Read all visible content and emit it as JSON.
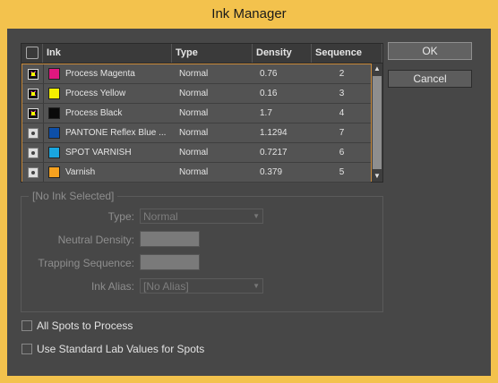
{
  "window": {
    "title": "Ink Manager"
  },
  "columns": {
    "icon": "",
    "ink": "Ink",
    "type": "Type",
    "density": "Density",
    "sequence": "Sequence"
  },
  "inks": [
    {
      "kind": "process",
      "color": "#e0177f",
      "name": "Process Magenta",
      "type": "Normal",
      "density": "0.76",
      "sequence": "2"
    },
    {
      "kind": "process",
      "color": "#f5f000",
      "name": "Process Yellow",
      "type": "Normal",
      "density": "0.16",
      "sequence": "3"
    },
    {
      "kind": "process",
      "color": "#0a0a0a",
      "name": "Process Black",
      "type": "Normal",
      "density": "1.7",
      "sequence": "4"
    },
    {
      "kind": "spot",
      "color": "#0d4fa8",
      "name": "PANTONE Reflex Blue ...",
      "type": "Normal",
      "density": "1.1294",
      "sequence": "7"
    },
    {
      "kind": "spot",
      "color": "#1aa6e0",
      "name": "SPOT VARNISH",
      "type": "Normal",
      "density": "0.7217",
      "sequence": "6"
    },
    {
      "kind": "spot",
      "color": "#f7a21f",
      "name": "Varnish",
      "type": "Normal",
      "density": "0.379",
      "sequence": "5"
    }
  ],
  "buttons": {
    "ok": "OK",
    "cancel": "Cancel"
  },
  "settings": {
    "group_title": "[No Ink Selected]",
    "type_label": "Type:",
    "type_value": "Normal",
    "neutral_density_label": "Neutral Density:",
    "trapping_sequence_label": "Trapping Sequence:",
    "ink_alias_label": "Ink Alias:",
    "ink_alias_value": "[No Alias]"
  },
  "options": {
    "all_spots_to_process": "All Spots to Process",
    "use_standard_lab": "Use Standard Lab Values for Spots"
  }
}
